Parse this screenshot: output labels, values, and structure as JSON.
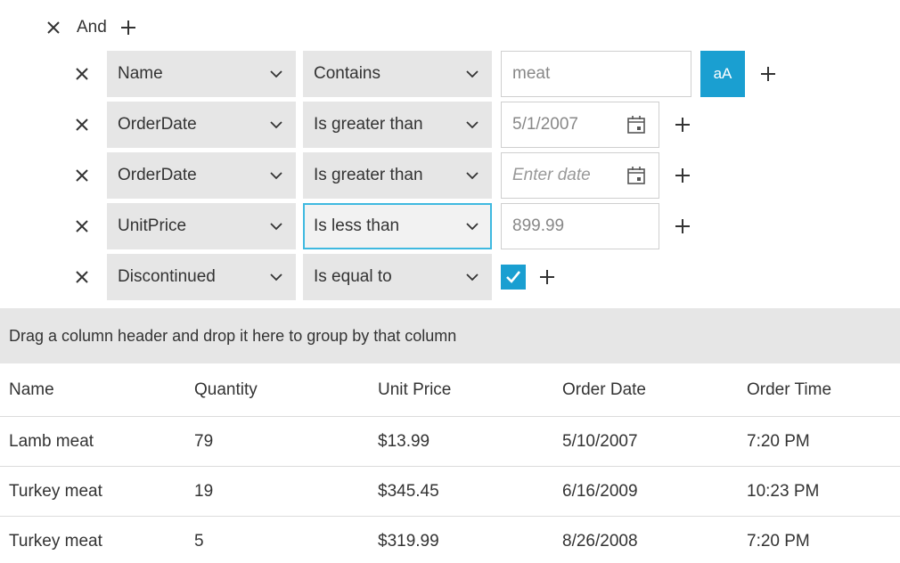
{
  "filter": {
    "logic_label": "And",
    "rows": [
      {
        "field": "Name",
        "operator": "Contains",
        "value": "meat",
        "kind": "text",
        "case_label": "aA"
      },
      {
        "field": "OrderDate",
        "operator": "Is greater than",
        "value": "5/1/2007",
        "kind": "date"
      },
      {
        "field": "OrderDate",
        "operator": "Is greater than",
        "placeholder": "Enter date",
        "kind": "date-empty"
      },
      {
        "field": "UnitPrice",
        "operator": "Is less than",
        "value": "899.99",
        "kind": "number"
      },
      {
        "field": "Discontinued",
        "operator": "Is equal to",
        "checked": true,
        "kind": "bool"
      }
    ]
  },
  "group_panel": {
    "text": "Drag a column header and drop it here to group by that column"
  },
  "grid": {
    "columns": [
      "Name",
      "Quantity",
      "Unit Price",
      "Order Date",
      "Order Time"
    ],
    "rows": [
      [
        "Lamb meat",
        "79",
        "$13.99",
        "5/10/2007",
        "7:20 PM"
      ],
      [
        "Turkey meat",
        "19",
        "$345.45",
        "6/16/2009",
        "10:23 PM"
      ],
      [
        "Turkey meat",
        "5",
        "$319.99",
        "8/26/2008",
        "7:20 PM"
      ]
    ]
  },
  "colors": {
    "accent": "#1a9fd1",
    "focus_border": "#3fb9e0",
    "panel_bg": "#e6e6e6"
  },
  "icons": [
    "close-icon",
    "plus-icon",
    "chevron-down-icon",
    "calendar-icon",
    "checkmark-icon"
  ]
}
